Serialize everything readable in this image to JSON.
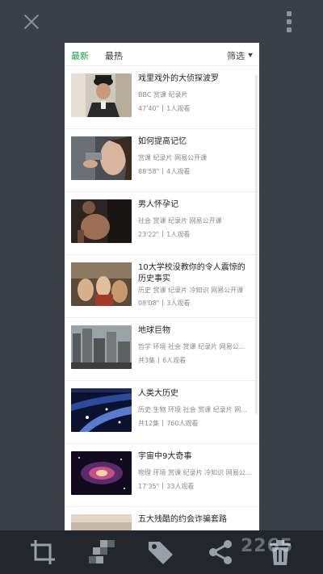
{
  "tabs": {
    "latest": "最新",
    "hot": "最热",
    "filter": "筛选"
  },
  "items": [
    {
      "title": "戏里戏外的大侦探波罗",
      "tags": "BBC 赏课 纪录片",
      "duration": "47'40\"",
      "views": "1人观看"
    },
    {
      "title": "如何提高记忆",
      "tags": "赏课 纪录片 网易公开课",
      "duration": "88'58\"",
      "views": "4人观看"
    },
    {
      "title": "男人怀孕记",
      "tags": "社会 赏课 纪录片 网易公开课",
      "duration": "23'22\"",
      "views": "1人观看"
    },
    {
      "title": "10大学校没教你的令人震惊的历史事实",
      "tags": "历史 赏课 纪录片 冷知识 网易公开课",
      "duration": "08'08\"",
      "views": "3人观看"
    },
    {
      "title": "地球巨物",
      "tags": "哲学 环境 社会 赏课 纪录片 网易公...",
      "duration": "共3集",
      "views": "6人观看"
    },
    {
      "title": "人类大历史",
      "tags": "历史 生物 环境 社会 赏课 纪录片 网...",
      "duration": "共12集",
      "views": "760人观看"
    },
    {
      "title": "宇宙中9大奇事",
      "tags": "物理 环境 赏课 纪录片 冷知识 网易公...",
      "duration": "17'35\"",
      "views": "33人观看"
    },
    {
      "title": "五大残酷的约会诈骗套路",
      "tags": "",
      "duration": "",
      "views": ""
    }
  ],
  "watermark": "2265",
  "icons": {
    "close": "close-icon",
    "more": "more-vertical-icon",
    "crop": "crop-icon",
    "mosaic": "mosaic-icon",
    "tag": "tag-icon",
    "share": "share-icon",
    "delete": "trash-icon"
  },
  "colors": {
    "accent": "#1b9a47",
    "background": "#3a4049",
    "bottombar": "#23272d"
  }
}
